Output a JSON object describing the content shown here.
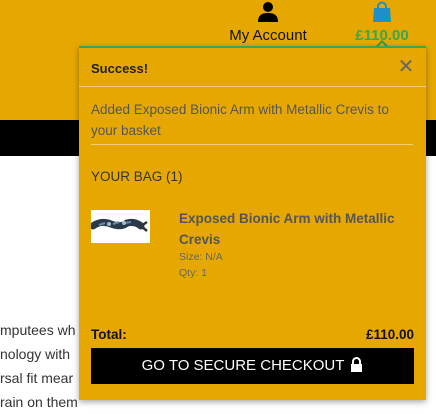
{
  "nav": {
    "account_label": "My Account",
    "account_icon": "user-icon",
    "bag_icon": "shopping-bag-icon",
    "bag_total": "£110.00"
  },
  "page": {
    "body_lines": [
      "mputees wh",
      "nology with",
      "rsal fit mear",
      "rain on them"
    ]
  },
  "toast": {
    "title": "Success!",
    "close_icon": "close-icon",
    "message": "Added Exposed Bionic Arm with Metallic Crevis to your basket",
    "bag_heading": "YOUR BAG (1)",
    "item": {
      "name": "Exposed Bionic Arm with Metallic Crevis",
      "size": "Size: N/A",
      "qty": "Qty: 1"
    },
    "total_label": "Total:",
    "total_value": "£110.00",
    "checkout_label": "GO TO SECURE CHECKOUT",
    "checkout_icon": "lock-icon"
  },
  "colors": {
    "brand_yellow": "#e6a800",
    "success_green": "#34a853",
    "dark": "#000000"
  }
}
